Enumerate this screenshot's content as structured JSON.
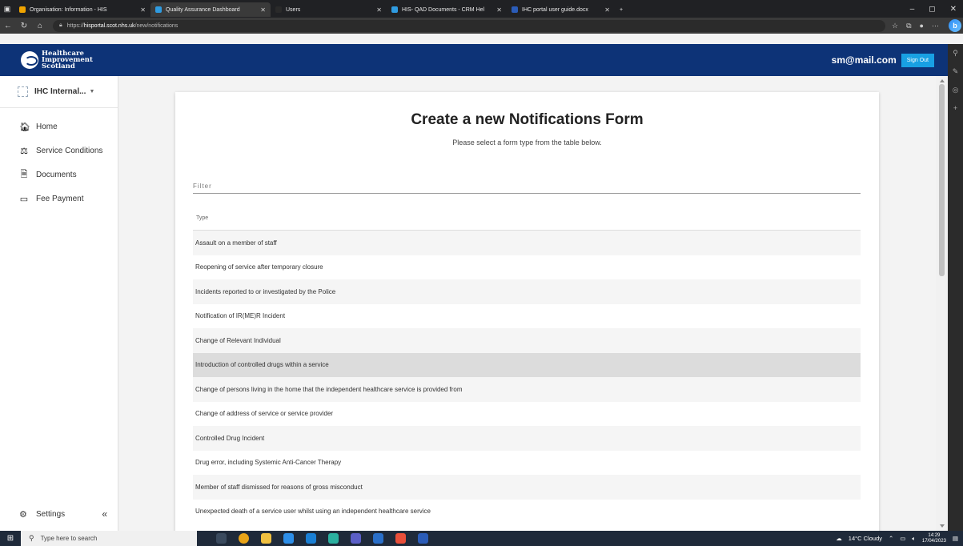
{
  "browser": {
    "tabs": [
      {
        "title": "Organisation: Information - HIS",
        "color": "#f0a400",
        "active": false
      },
      {
        "title": "Quality Assurance Dashboard",
        "color": "#2f9be0",
        "active": true
      },
      {
        "title": "Users",
        "color": "#202124",
        "active": false
      },
      {
        "title": "HIS- QAD Documents - CRM Hel",
        "color": "#2f9be0",
        "active": false
      },
      {
        "title": "IHC portal user guide.docx",
        "color": "#2b5cb8",
        "active": false
      }
    ],
    "new_tab": "+",
    "url_scheme": "https://",
    "url_host": "hisportal.scot.nhs.uk",
    "url_path": "/new/notifications"
  },
  "header": {
    "logo_line1": "Healthcare",
    "logo_line2": "Improvement",
    "logo_line3": "Scotland",
    "user_email": "sm@mail.com",
    "sign_out": "Sign Out"
  },
  "sidebar": {
    "org_name": "IHC Internal...",
    "items": [
      {
        "label": "Home",
        "icon": "home-icon"
      },
      {
        "label": "Service Conditions",
        "icon": "gavel-icon"
      },
      {
        "label": "Documents",
        "icon": "document-icon"
      },
      {
        "label": "Fee Payment",
        "icon": "card-icon"
      }
    ],
    "settings_label": "Settings",
    "collapse": "«"
  },
  "main": {
    "title": "Create a new Notifications Form",
    "subtitle": "Please select a form type from the table below.",
    "filter_placeholder": "Filter",
    "column_header": "Type",
    "rows": [
      "Assault on a member of staff",
      "Reopening of service after temporary closure",
      "Incidents reported to or investigated by the Police",
      "Notification of IR(ME)R Incident",
      "Change of Relevant Individual",
      "Introduction of controlled drugs within a service",
      "Change of persons living in the home that the independent healthcare service is provided from",
      "Change of address of service or service provider",
      "Controlled Drug Incident",
      "Drug error, including Systemic Anti-Cancer Therapy",
      "Member of staff dismissed for reasons of gross misconduct",
      "Unexpected death of a service user whilst using an independent healthcare service"
    ],
    "selected_row": 5
  },
  "taskbar": {
    "search_placeholder": "Type here to search",
    "weather": "14°C  Cloudy",
    "time": "14:29",
    "date": "17/04/2023"
  },
  "colors": {
    "header_bg": "#0d3377",
    "sign_out_bg": "#18a0e3"
  }
}
